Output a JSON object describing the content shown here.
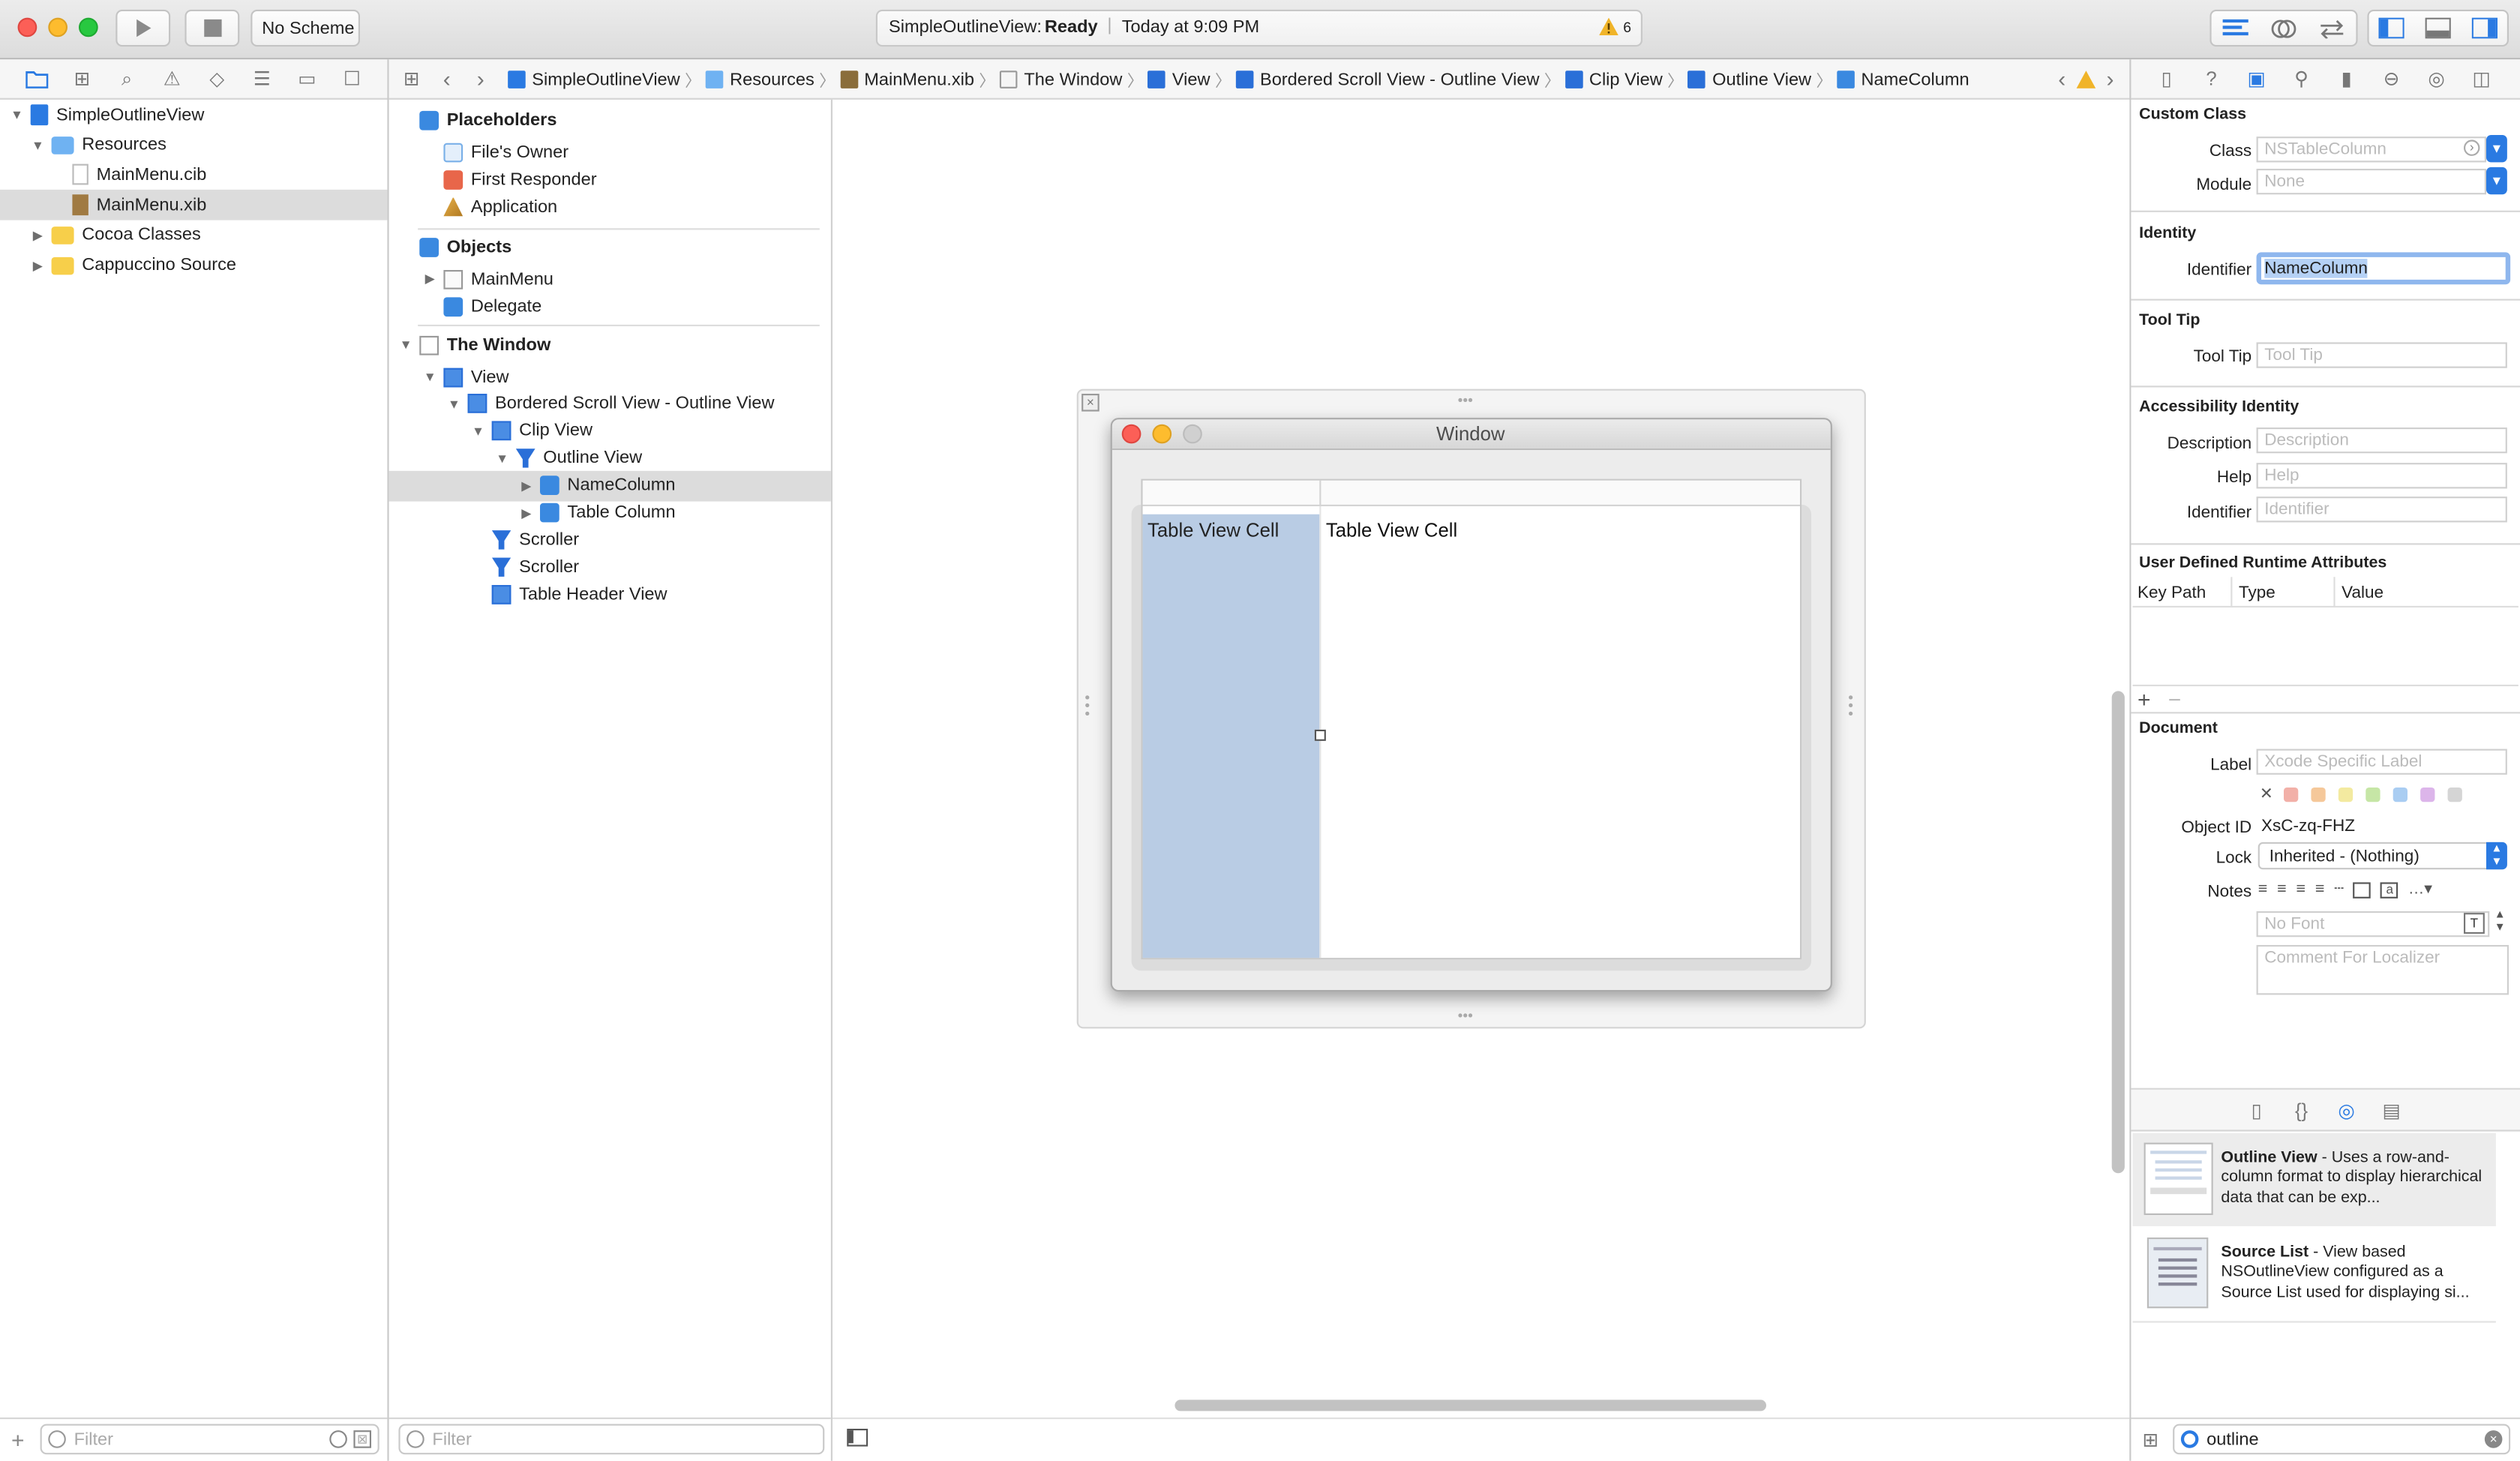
{
  "toolbar": {
    "scheme": "No Scheme",
    "status_project": "SimpleOutlineView:",
    "status_state": "Ready",
    "status_time": "Today at 9:09 PM",
    "warning_count": "6"
  },
  "breadcrumbs": [
    {
      "label": "SimpleOutlineView",
      "icon": "project-icon"
    },
    {
      "label": "Resources",
      "icon": "folder-icon"
    },
    {
      "label": "MainMenu.xib",
      "icon": "xib-icon"
    },
    {
      "label": "The Window",
      "icon": "window-icon"
    },
    {
      "label": "View",
      "icon": "view-icon"
    },
    {
      "label": "Bordered Scroll View - Outline View",
      "icon": "view-icon"
    },
    {
      "label": "Clip View",
      "icon": "view-icon"
    },
    {
      "label": "Outline View",
      "icon": "outline-icon"
    },
    {
      "label": "NameColumn",
      "icon": "cube-icon"
    }
  ],
  "navigator": {
    "items": [
      {
        "label": "SimpleOutlineView",
        "level": 0,
        "open": true,
        "icon": "project"
      },
      {
        "label": "Resources",
        "level": 1,
        "open": true,
        "icon": "folder-blue"
      },
      {
        "label": "MainMenu.cib",
        "level": 2,
        "icon": "file"
      },
      {
        "label": "MainMenu.xib",
        "level": 2,
        "icon": "xib",
        "selected": true
      },
      {
        "label": "Cocoa Classes",
        "level": 1,
        "open": false,
        "icon": "folder"
      },
      {
        "label": "Cappuccino Source",
        "level": 1,
        "open": false,
        "icon": "folder"
      }
    ],
    "filter_placeholder": "Filter"
  },
  "outline": {
    "placeholders_title": "Placeholders",
    "placeholders": [
      "File's Owner",
      "First Responder",
      "Application"
    ],
    "objects_title": "Objects",
    "objects": [
      "MainMenu",
      "Delegate"
    ],
    "window_title": "The Window",
    "tree": [
      {
        "label": "View",
        "level": 1
      },
      {
        "label": "Bordered Scroll View - Outline View",
        "level": 2
      },
      {
        "label": "Clip View",
        "level": 3
      },
      {
        "label": "Outline View",
        "level": 4
      },
      {
        "label": "NameColumn",
        "level": 5,
        "selected": true
      },
      {
        "label": "Table Column",
        "level": 5
      },
      {
        "label": "Scroller",
        "level": 3
      },
      {
        "label": "Scroller",
        "level": 3
      },
      {
        "label": "Table Header View",
        "level": 3
      }
    ],
    "filter_placeholder": "Filter"
  },
  "canvas": {
    "window_title": "Window",
    "cell_left": "Table View Cell",
    "cell_right": "Table View Cell"
  },
  "inspector": {
    "custom_class": "Custom Class",
    "class_label": "Class",
    "class_placeholder": "NSTableColumn",
    "module_label": "Module",
    "module_placeholder": "None",
    "identity": "Identity",
    "identifier_label": "Identifier",
    "identifier_value": "NameColumn",
    "tooltip_title": "Tool Tip",
    "tooltip_label": "Tool Tip",
    "tooltip_placeholder": "Tool Tip",
    "accessibility": "Accessibility Identity",
    "description_label": "Description",
    "description_placeholder": "Description",
    "help_label": "Help",
    "help_placeholder": "Help",
    "acc_identifier_label": "Identifier",
    "acc_identifier_placeholder": "Identifier",
    "udra": "User Defined Runtime Attributes",
    "udra_cols": [
      "Key Path",
      "Type",
      "Value"
    ],
    "document": "Document",
    "label_label": "Label",
    "label_placeholder": "Xcode Specific Label",
    "object_id_label": "Object ID",
    "object_id_value": "XsC-zq-FHZ",
    "lock_label": "Lock",
    "lock_value": "Inherited - (Nothing)",
    "notes_label": "Notes",
    "font_placeholder": "No Font",
    "comment_placeholder": "Comment For Localizer",
    "label_colors": [
      "#f2b0a8",
      "#f5c89a",
      "#f3eaa0",
      "#c6e6a6",
      "#a9cdf2",
      "#dcb5ea",
      "#d5d5d5"
    ]
  },
  "library": {
    "items": [
      {
        "title": "Outline View",
        "desc": " - Uses a row-and-column format to display hierarchical data that can be exp..."
      },
      {
        "title": "Source List",
        "desc": " - View based NSOutlineView configured as a Source List used for displaying si..."
      }
    ],
    "search_value": "outline"
  }
}
